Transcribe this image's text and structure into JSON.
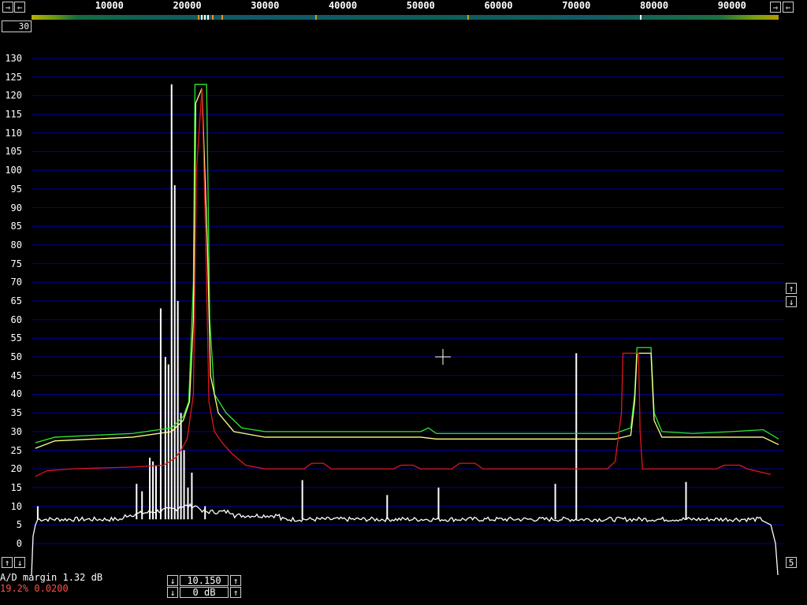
{
  "top_scale": {
    "left_button": "⇾",
    "back_button": "⇽",
    "right_button": "⇾",
    "end_button": "⇽",
    "ticks": [
      "10000",
      "20000",
      "30000",
      "40000",
      "50000",
      "60000",
      "70000",
      "80000",
      "90000"
    ]
  },
  "scale_box": {
    "value": "30"
  },
  "y_axis": {
    "labels": [
      "0",
      "5",
      "10",
      "15",
      "20",
      "25",
      "30",
      "35",
      "40",
      "45",
      "50",
      "55",
      "60",
      "65",
      "70",
      "75",
      "80",
      "85",
      "90",
      "95",
      "100",
      "105",
      "110",
      "115",
      "120",
      "125",
      "130"
    ]
  },
  "side_buttons": {
    "up": "↑",
    "down": "↓",
    "five": "5"
  },
  "status": {
    "ad_margin": "A/D margin 1.32 dB",
    "percent": "19.2% 0.0200"
  },
  "bottom_controls": {
    "value1": "10.150",
    "value2": "0 dB",
    "up": "↑",
    "down": "↓"
  },
  "colors": {
    "grid": "#0000a0",
    "green": "#2ee82e",
    "yellow": "#ffff88",
    "red": "#e01818",
    "white": "#ffffff"
  },
  "chart_data": {
    "type": "line",
    "x_range": [
      0,
      96000
    ],
    "y_range": [
      0,
      130
    ],
    "grid": true,
    "series": [
      {
        "color": "green",
        "points": [
          [
            500,
            27
          ],
          [
            3000,
            28.5
          ],
          [
            8000,
            29
          ],
          [
            13000,
            29.5
          ],
          [
            18000,
            31
          ],
          [
            19500,
            34
          ],
          [
            20200,
            38
          ],
          [
            20800,
            70
          ],
          [
            21000,
            123
          ],
          [
            22500,
            123
          ],
          [
            22900,
            60
          ],
          [
            23500,
            40
          ],
          [
            25000,
            35
          ],
          [
            27000,
            31
          ],
          [
            30000,
            30
          ],
          [
            40000,
            30
          ],
          [
            50000,
            30
          ],
          [
            51000,
            31
          ],
          [
            52000,
            29.5
          ],
          [
            60000,
            29.5
          ],
          [
            70000,
            29.5
          ],
          [
            75000,
            29.5
          ],
          [
            77000,
            31
          ],
          [
            77500,
            40
          ],
          [
            77800,
            52.5
          ],
          [
            79600,
            52.5
          ],
          [
            80000,
            35
          ],
          [
            81000,
            30
          ],
          [
            85000,
            29.5
          ],
          [
            90000,
            30
          ],
          [
            94000,
            30.5
          ],
          [
            96000,
            28
          ]
        ]
      },
      {
        "color": "yellow",
        "points": [
          [
            500,
            25.5
          ],
          [
            3000,
            27.5
          ],
          [
            8000,
            28
          ],
          [
            13000,
            28.5
          ],
          [
            18000,
            30
          ],
          [
            19500,
            33
          ],
          [
            20300,
            38
          ],
          [
            20800,
            60
          ],
          [
            21100,
            118
          ],
          [
            21900,
            122
          ],
          [
            22600,
            80
          ],
          [
            23000,
            45
          ],
          [
            24000,
            35
          ],
          [
            26000,
            30
          ],
          [
            30000,
            28.5
          ],
          [
            40000,
            28.5
          ],
          [
            50000,
            28.5
          ],
          [
            52000,
            28
          ],
          [
            60000,
            28
          ],
          [
            70000,
            28
          ],
          [
            75000,
            28
          ],
          [
            77000,
            29
          ],
          [
            77500,
            38
          ],
          [
            77800,
            51
          ],
          [
            79600,
            51
          ],
          [
            80000,
            33
          ],
          [
            81000,
            28.5
          ],
          [
            90000,
            28.5
          ],
          [
            94000,
            28.5
          ],
          [
            96000,
            26.5
          ]
        ]
      },
      {
        "color": "red",
        "points": [
          [
            500,
            18
          ],
          [
            2000,
            19.5
          ],
          [
            5000,
            20
          ],
          [
            13000,
            20.5
          ],
          [
            17000,
            21
          ],
          [
            18500,
            23
          ],
          [
            19200,
            25
          ],
          [
            20000,
            28
          ],
          [
            20800,
            40
          ],
          [
            21200,
            100
          ],
          [
            21900,
            122
          ],
          [
            22400,
            80
          ],
          [
            22800,
            38
          ],
          [
            23500,
            30
          ],
          [
            24500,
            27
          ],
          [
            25800,
            24
          ],
          [
            27500,
            21
          ],
          [
            30000,
            20
          ],
          [
            35000,
            20
          ],
          [
            36000,
            21.5
          ],
          [
            37500,
            21.5
          ],
          [
            38500,
            20
          ],
          [
            46500,
            20
          ],
          [
            47500,
            21
          ],
          [
            49000,
            21
          ],
          [
            50000,
            20
          ],
          [
            54000,
            20
          ],
          [
            55000,
            21.5
          ],
          [
            57000,
            21.5
          ],
          [
            58000,
            20
          ],
          [
            74000,
            20
          ],
          [
            75000,
            22
          ],
          [
            75800,
            35
          ],
          [
            76000,
            51
          ],
          [
            78000,
            51
          ],
          [
            78200,
            30
          ],
          [
            78500,
            20
          ],
          [
            88000,
            20
          ],
          [
            89000,
            21
          ],
          [
            91000,
            21
          ],
          [
            92000,
            20
          ],
          [
            95000,
            18.5
          ]
        ]
      }
    ],
    "spikes": [
      [
        800,
        10
      ],
      [
        13500,
        16
      ],
      [
        14200,
        14
      ],
      [
        15200,
        23
      ],
      [
        15600,
        22
      ],
      [
        16000,
        21
      ],
      [
        16600,
        63
      ],
      [
        17200,
        50
      ],
      [
        17600,
        48
      ],
      [
        18000,
        123
      ],
      [
        18400,
        96
      ],
      [
        18800,
        65
      ],
      [
        19200,
        35
      ],
      [
        19600,
        25
      ],
      [
        20100,
        15
      ],
      [
        20600,
        19
      ],
      [
        22300,
        10
      ],
      [
        34800,
        17
      ],
      [
        45700,
        13
      ],
      [
        52300,
        15
      ],
      [
        67300,
        16
      ],
      [
        70000,
        51
      ],
      [
        84100,
        16.5
      ]
    ]
  }
}
